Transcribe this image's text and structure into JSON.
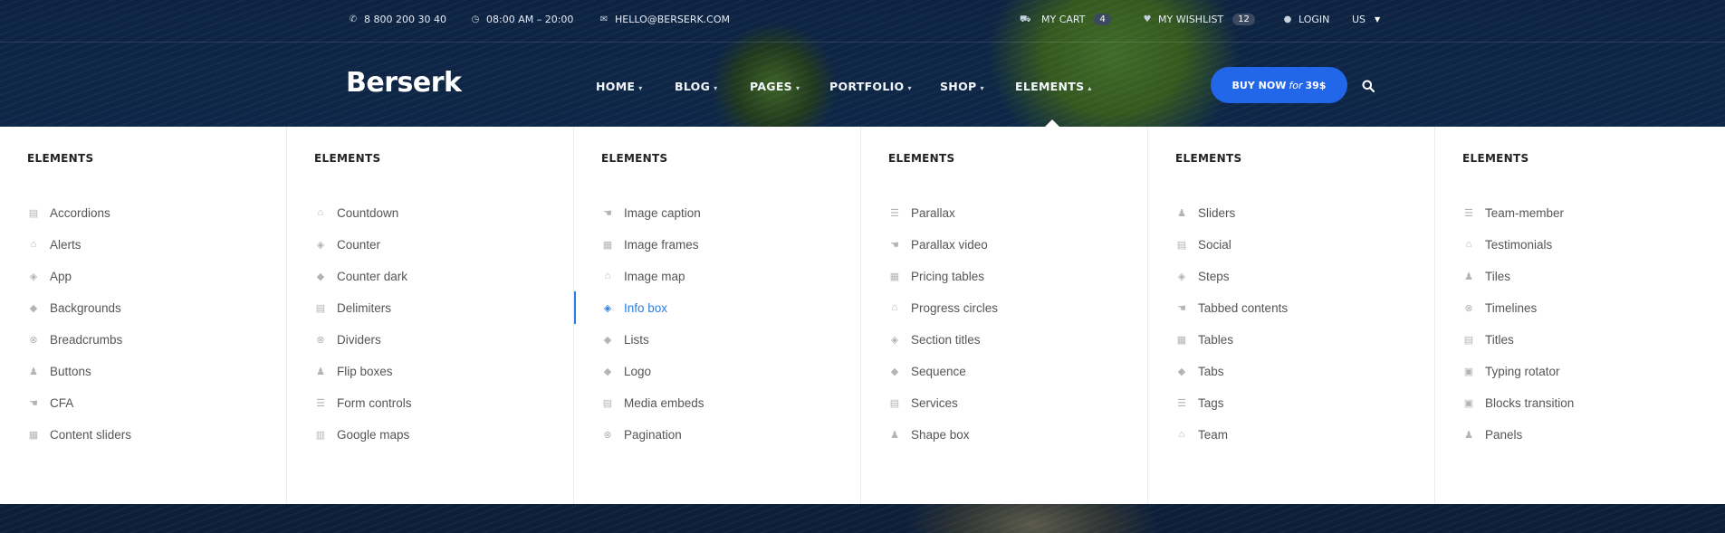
{
  "topbar": {
    "phone": "8 800 200 30 40",
    "hours": "08:00 AM – 20:00",
    "email": "HELLO@BERSERK.COM",
    "cart_label": "MY CART",
    "cart_count": "4",
    "wishlist_label": "MY WISHLIST",
    "wishlist_count": "12",
    "login_label": "LOGIN",
    "locale": "US"
  },
  "brand": {
    "logo_text": "Berserk"
  },
  "nav": {
    "items": [
      "HOME",
      "BLOG",
      "PAGES",
      "PORTFOLIO",
      "SHOP",
      "ELEMENTS"
    ],
    "buy_label": "BUY NOW",
    "buy_for": "for",
    "buy_price": "39$"
  },
  "colors": {
    "accent": "#2266ea",
    "active_link": "#2b7de1"
  },
  "mega": {
    "columns": [
      {
        "title": "ELEMENTS",
        "items": [
          {
            "label": "Accordions",
            "icon": "card-icon"
          },
          {
            "label": "Alerts",
            "icon": "bank-icon"
          },
          {
            "label": "App",
            "icon": "cube-icon"
          },
          {
            "label": "Backgrounds",
            "icon": "diamond-icon"
          },
          {
            "label": "Breadcrumbs",
            "icon": "lifebuoy-icon"
          },
          {
            "label": "Buttons",
            "icon": "person-icon"
          },
          {
            "label": "CFA",
            "icon": "hand-icon"
          },
          {
            "label": "Content sliders",
            "icon": "grid-icon"
          }
        ]
      },
      {
        "title": "ELEMENTS",
        "items": [
          {
            "label": "Countdown",
            "icon": "bank-icon"
          },
          {
            "label": "Counter",
            "icon": "cube-icon"
          },
          {
            "label": "Counter dark",
            "icon": "diamond-icon"
          },
          {
            "label": "Delimiters",
            "icon": "card-icon"
          },
          {
            "label": "Dividers",
            "icon": "lifebuoy-icon"
          },
          {
            "label": "Flip boxes",
            "icon": "person-icon"
          },
          {
            "label": "Form controls",
            "icon": "list-icon"
          },
          {
            "label": "Google maps",
            "icon": "map-icon"
          }
        ]
      },
      {
        "title": "ELEMENTS",
        "items": [
          {
            "label": "Image caption",
            "icon": "hand-icon"
          },
          {
            "label": "Image frames",
            "icon": "grid-icon"
          },
          {
            "label": "Image map",
            "icon": "bank-icon"
          },
          {
            "label": "Info box",
            "icon": "cube-icon",
            "active": true
          },
          {
            "label": "Lists",
            "icon": "diamond-icon"
          },
          {
            "label": "Logo",
            "icon": "diamond-icon"
          },
          {
            "label": "Media embeds",
            "icon": "card-icon"
          },
          {
            "label": "Pagination",
            "icon": "lifebuoy-icon"
          }
        ]
      },
      {
        "title": "ELEMENTS",
        "items": [
          {
            "label": "Parallax",
            "icon": "list-icon"
          },
          {
            "label": "Parallax video",
            "icon": "hand-icon"
          },
          {
            "label": "Pricing tables",
            "icon": "grid-icon"
          },
          {
            "label": "Progress circles",
            "icon": "bank-icon"
          },
          {
            "label": "Section titles",
            "icon": "cube-icon"
          },
          {
            "label": "Sequence",
            "icon": "diamond-icon"
          },
          {
            "label": "Services",
            "icon": "card-icon"
          },
          {
            "label": "Shape box",
            "icon": "person-icon"
          }
        ]
      },
      {
        "title": "ELEMENTS",
        "items": [
          {
            "label": "Sliders",
            "icon": "person-icon"
          },
          {
            "label": "Social",
            "icon": "card-icon"
          },
          {
            "label": "Steps",
            "icon": "cube-icon"
          },
          {
            "label": "Tabbed contents",
            "icon": "hand-icon"
          },
          {
            "label": "Tables",
            "icon": "grid-icon"
          },
          {
            "label": "Tabs",
            "icon": "diamond-icon"
          },
          {
            "label": "Tags",
            "icon": "list-icon"
          },
          {
            "label": "Team",
            "icon": "bank-icon"
          }
        ]
      },
      {
        "title": "ELEMENTS",
        "items": [
          {
            "label": "Team-member",
            "icon": "list-icon"
          },
          {
            "label": "Testimonials",
            "icon": "bank-icon"
          },
          {
            "label": "Tiles",
            "icon": "person-icon"
          },
          {
            "label": "Timelines",
            "icon": "lifebuoy-icon"
          },
          {
            "label": "Titles",
            "icon": "card-icon"
          },
          {
            "label": "Typing rotator",
            "icon": "image-icon"
          },
          {
            "label": "Blocks transition",
            "icon": "image-icon"
          },
          {
            "label": "Panels",
            "icon": "person-icon"
          }
        ]
      }
    ]
  }
}
